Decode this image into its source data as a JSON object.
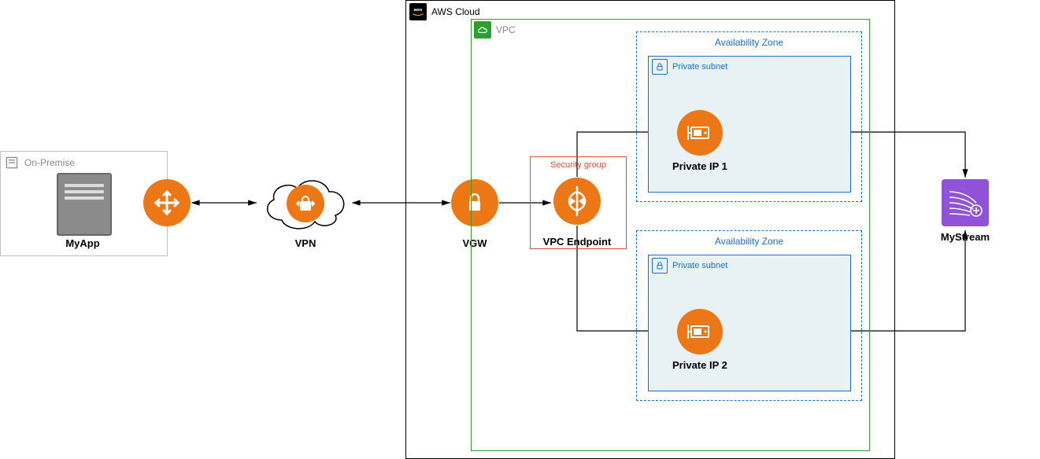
{
  "onprem": {
    "title": "On-Premise",
    "app_label": "MyApp"
  },
  "network": {
    "router_alt": "router",
    "cgw_name": "customer-gateway",
    "vpn_label": "VPN",
    "vgw_label": "VGW"
  },
  "aws": {
    "title": "AWS Cloud",
    "vpc_title": "VPC",
    "sg_title": "Security group",
    "vpc_endpoint_label": "VPC Endpoint",
    "az1": {
      "title": "Availability Zone",
      "subnet_title": "Private subnet",
      "eni_label": "Private IP 1"
    },
    "az2": {
      "title": "Availability Zone",
      "subnet_title": "Private subnet",
      "eni_label": "Private IP 2"
    },
    "kinesis_label": "MyStream"
  }
}
